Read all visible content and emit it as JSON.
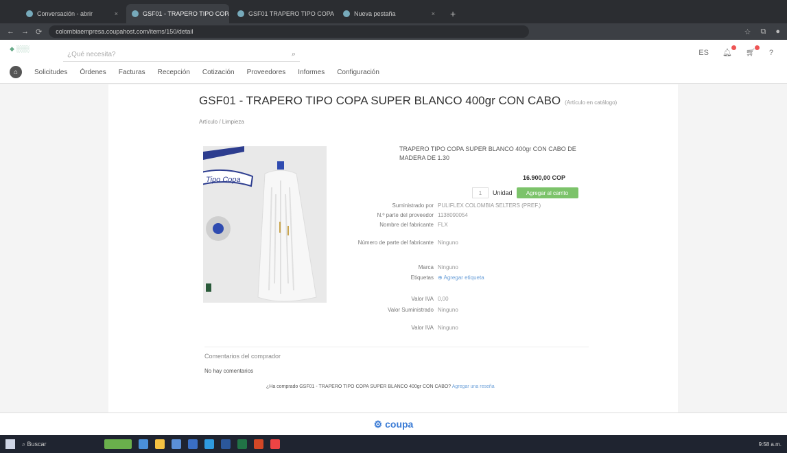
{
  "browser": {
    "tabs": [
      {
        "label": "Conversación - abrir"
      },
      {
        "label": "GSF01 - TRAPERO TIPO COPA"
      },
      {
        "label": "GSF01 TRAPERO TIPO COPA"
      },
      {
        "label": "Nueva pestaña"
      }
    ],
    "url": "colombiaempresa.coupahost.com/items/150/detail"
  },
  "header": {
    "search_placeholder": "¿Qué necesita?",
    "nav": [
      "Solicitudes",
      "Órdenes",
      "Facturas",
      "Recepción",
      "Cotización",
      "Proveedores",
      "Informes",
      "Configuración"
    ]
  },
  "product": {
    "title": "GSF01 - TRAPERO TIPO COPA SUPER BLANCO 400gr CON CABO",
    "title_tag": "(Artículo en catálogo)",
    "breadcrumb": "Artículo / Limpieza",
    "image_label": "Tipo Copa",
    "description": "TRAPERO TIPO COPA SUPER BLANCO 400gr CON CABO DE MADERA DE 1.30",
    "price": "16.900,00 COP",
    "qty_placeholder": "1",
    "unit": "Unidad",
    "add_button": "Agregar al carrito",
    "fields": [
      {
        "label": "Suministrado por",
        "value": "PULIFLEX COLOMBIA SELTERS (PREF.)",
        "link": false
      },
      {
        "label": "N.º parte del proveedor",
        "value": "1138090054",
        "link": false
      },
      {
        "label": "Nombre del fabricante",
        "value": "FLX",
        "link": false
      },
      {
        "label": "Número de parte del fabricante",
        "value": "Ninguno",
        "link": false
      },
      {
        "label": "Marca",
        "value": "Ninguno",
        "link": false
      },
      {
        "label": "Etiquetas",
        "value": "Agregar etiqueta",
        "link": true
      },
      {
        "label": "Valor IVA",
        "value": "0,00",
        "link": false
      },
      {
        "label": "Valor Suministrado",
        "value": "Ninguno",
        "link": false
      },
      {
        "label": "Valor IVA",
        "value": "Ninguno",
        "link": false
      }
    ]
  },
  "comments": {
    "heading": "Comentarios del comprador",
    "none": "No hay comentarios",
    "question": "¿Ha comprado GSF01 - TRAPERO TIPO COPA SUPER BLANCO 400gr CON CABO?",
    "question_link": "Agregar una reseña"
  },
  "footer": {
    "brand": "coupa"
  },
  "taskbar": {
    "search": "Buscar",
    "time": "9:58 a.m."
  }
}
